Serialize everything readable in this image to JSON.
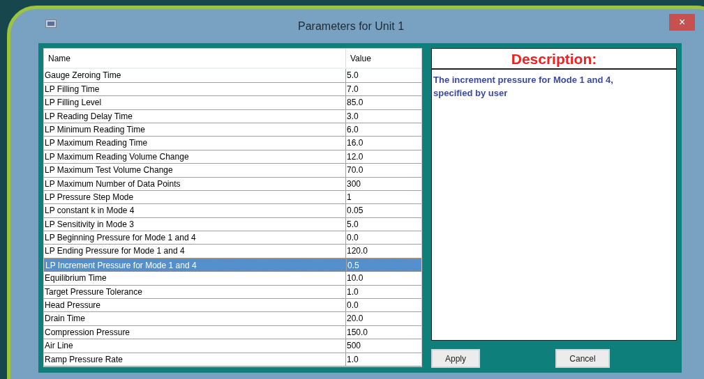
{
  "window": {
    "title": "Parameters for Unit 1",
    "close": "×"
  },
  "table": {
    "columns": [
      "Name",
      "Value"
    ],
    "rows": [
      {
        "name": "Gauge Zeroing Time",
        "value": "5.0",
        "selected": false
      },
      {
        "name": "LP Filling Time",
        "value": "7.0",
        "selected": false
      },
      {
        "name": "LP Filling Level",
        "value": "85.0",
        "selected": false
      },
      {
        "name": "LP Reading Delay Time",
        "value": "3.0",
        "selected": false
      },
      {
        "name": "LP Minimum Reading Time",
        "value": "6.0",
        "selected": false
      },
      {
        "name": "LP Maximum Reading Time",
        "value": "16.0",
        "selected": false
      },
      {
        "name": "LP Maximum Reading Volume Change",
        "value": "12.0",
        "selected": false
      },
      {
        "name": "LP Maximum Test Volume Change",
        "value": "70.0",
        "selected": false
      },
      {
        "name": "LP Maximum Number of Data Points",
        "value": "300",
        "selected": false
      },
      {
        "name": "LP Pressure Step Mode",
        "value": "1",
        "selected": false
      },
      {
        "name": "LP constant k in Mode 4",
        "value": "0.05",
        "selected": false
      },
      {
        "name": "LP Sensitivity in Mode 3",
        "value": "5.0",
        "selected": false
      },
      {
        "name": "LP Beginning Pressure for Mode 1 and 4",
        "value": "0.0",
        "selected": false
      },
      {
        "name": "LP Ending Pressure for Mode 1 and 4",
        "value": "120.0",
        "selected": false
      },
      {
        "name": "LP Increment Pressure for Mode 1 and 4",
        "value": "0.5",
        "selected": true
      },
      {
        "name": "Equilibrium Time",
        "value": "10.0",
        "selected": false
      },
      {
        "name": "Target Pressure Tolerance",
        "value": "1.0",
        "selected": false
      },
      {
        "name": "Head Pressure",
        "value": "0.0",
        "selected": false
      },
      {
        "name": "Drain Time",
        "value": "20.0",
        "selected": false
      },
      {
        "name": "Compression Pressure",
        "value": "150.0",
        "selected": false
      },
      {
        "name": "Air Line",
        "value": "500",
        "selected": false
      },
      {
        "name": "Ramp Pressure Rate",
        "value": "1.0",
        "selected": false
      }
    ]
  },
  "description": {
    "title": "Description:",
    "text": "The increment pressure for Mode 1 and 4, specified by user"
  },
  "buttons": [
    "Apply",
    "Cancel"
  ]
}
